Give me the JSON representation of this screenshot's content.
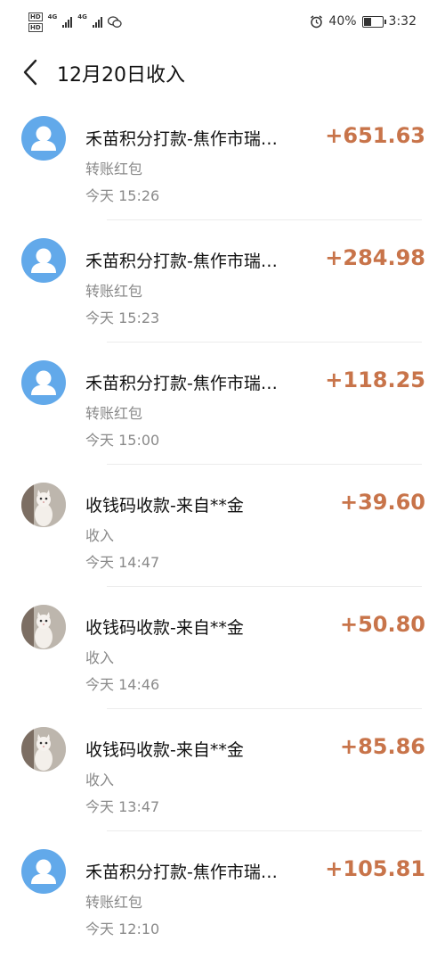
{
  "status_bar": {
    "hd1": "HD",
    "hd2": "HD",
    "net1": "4G",
    "net2": "4G",
    "battery_text": "40%",
    "battery_level": 0.4,
    "time": "3:32",
    "icons": [
      "hd-icon",
      "signal-icon",
      "wechat-icon",
      "alarm-icon",
      "battery-icon"
    ]
  },
  "header": {
    "title": "12月20日收入",
    "back_icon": "chevron-left-icon"
  },
  "colors": {
    "amount": "#c8744a",
    "avatar_default": "#62a9ea"
  },
  "items": [
    {
      "avatar": "default",
      "title": "禾苗积分打款-焦作市瑞…",
      "type": "转账红包",
      "day": "今天",
      "time": "15:26",
      "amount": "+651.63"
    },
    {
      "avatar": "default",
      "title": "禾苗积分打款-焦作市瑞…",
      "type": "转账红包",
      "day": "今天",
      "time": "15:23",
      "amount": "+284.98"
    },
    {
      "avatar": "default",
      "title": "禾苗积分打款-焦作市瑞…",
      "type": "转账红包",
      "day": "今天",
      "time": "15:00",
      "amount": "+118.25"
    },
    {
      "avatar": "cat",
      "title": "收钱码收款-来自**金",
      "type": "收入",
      "day": "今天",
      "time": "14:47",
      "amount": "+39.60"
    },
    {
      "avatar": "cat",
      "title": "收钱码收款-来自**金",
      "type": "收入",
      "day": "今天",
      "time": "14:46",
      "amount": "+50.80"
    },
    {
      "avatar": "cat",
      "title": "收钱码收款-来自**金",
      "type": "收入",
      "day": "今天",
      "time": "13:47",
      "amount": "+85.86"
    },
    {
      "avatar": "default",
      "title": "禾苗积分打款-焦作市瑞…",
      "type": "转账红包",
      "day": "今天",
      "time": "12:10",
      "amount": "+105.81"
    }
  ]
}
